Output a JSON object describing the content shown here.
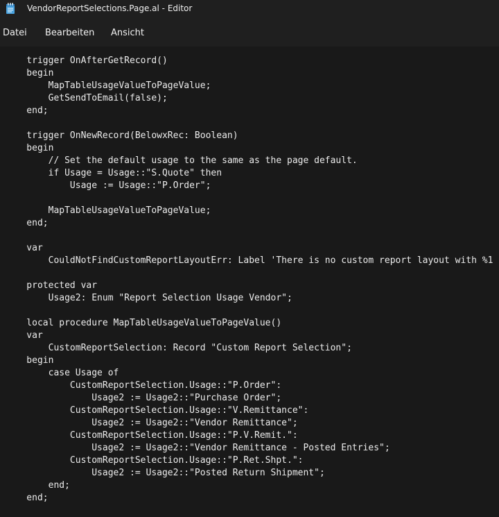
{
  "window": {
    "title": "VendorReportSelections.Page.al - Editor",
    "icon": "notepad-icon"
  },
  "menu": {
    "file": "Datei",
    "edit": "Bearbeiten",
    "view": "Ansicht"
  },
  "editor": {
    "lines": [
      "    trigger OnAfterGetRecord()",
      "    begin",
      "        MapTableUsageValueToPageValue;",
      "        GetSendToEmail(false);",
      "    end;",
      "",
      "    trigger OnNewRecord(BelowxRec: Boolean)",
      "    begin",
      "        // Set the default usage to the same as the page default.",
      "        if Usage = Usage::\"S.Quote\" then",
      "            Usage := Usage::\"P.Order\";",
      "",
      "        MapTableUsageValueToPageValue;",
      "    end;",
      "",
      "    var",
      "        CouldNotFindCustomReportLayoutErr: Label 'There is no custom report layout with %1",
      "",
      "    protected var",
      "        Usage2: Enum \"Report Selection Usage Vendor\";",
      "",
      "    local procedure MapTableUsageValueToPageValue()",
      "    var",
      "        CustomReportSelection: Record \"Custom Report Selection\";",
      "    begin",
      "        case Usage of",
      "            CustomReportSelection.Usage::\"P.Order\":",
      "                Usage2 := Usage2::\"Purchase Order\";",
      "            CustomReportSelection.Usage::\"V.Remittance\":",
      "                Usage2 := Usage2::\"Vendor Remittance\";",
      "            CustomReportSelection.Usage::\"P.V.Remit.\":",
      "                Usage2 := Usage2::\"Vendor Remittance - Posted Entries\";",
      "            CustomReportSelection.Usage::\"P.Ret.Shpt.\":",
      "                Usage2 := Usage2::\"Posted Return Shipment\";",
      "        end;",
      "    end;"
    ]
  }
}
